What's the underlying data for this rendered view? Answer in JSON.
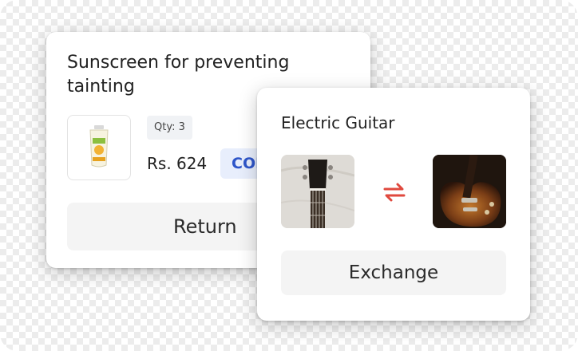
{
  "return_card": {
    "title": "Sunscreen for preventing tainting",
    "qty": "Qty: 3",
    "price": "Rs. 624",
    "payment_badge": "COD",
    "return_label": "Return",
    "product_icon": "sunscreen-tube-icon"
  },
  "exchange_card": {
    "title": "Electric Guitar",
    "swap_icon": "swap-arrows-icon",
    "swap_color": "#e0493e",
    "exchange_label": "Exchange"
  },
  "colors": {
    "badge_text": "#2f56c9",
    "badge_bg": "#e8eefc",
    "button_bg": "#f4f4f4"
  }
}
